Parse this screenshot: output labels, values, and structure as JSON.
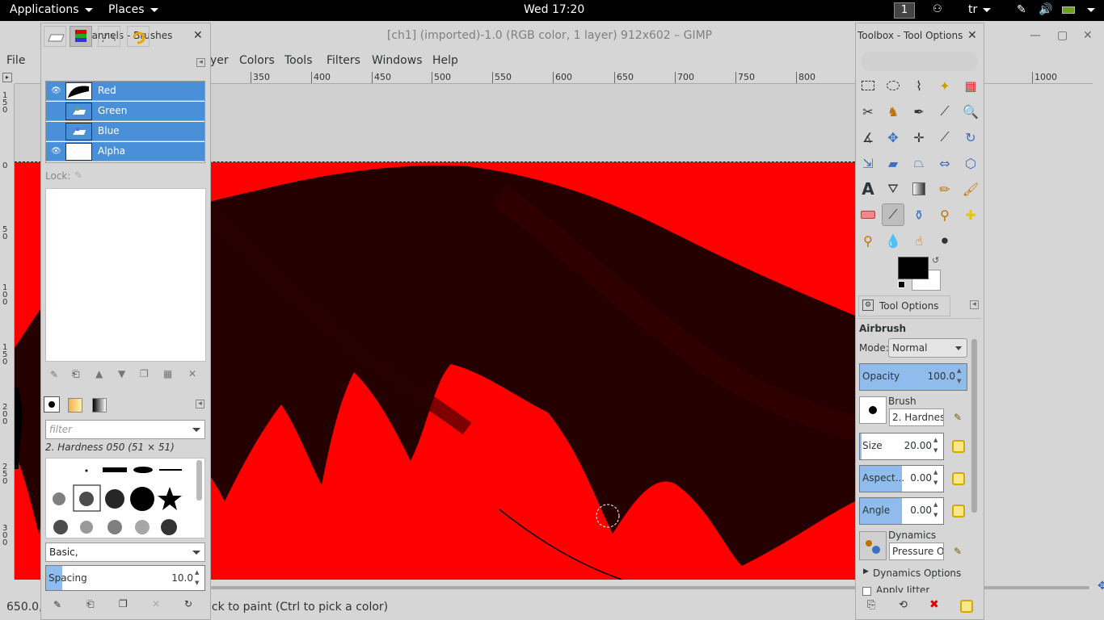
{
  "topbar": {
    "applications": "Applications",
    "places": "Places",
    "clock": "Wed 17:20",
    "workspace": "1",
    "lang": "tr"
  },
  "window": {
    "title": "[ch1] (imported)-1.0 (RGB color, 1 layer) 912x602 – GIMP"
  },
  "menubar": {
    "file": "File",
    "layer_partial": "yer",
    "colors": "Colors",
    "tools": "Tools",
    "filters": "Filters",
    "windows": "Windows",
    "help": "Help"
  },
  "ruler": {
    "h_labels": [
      "350",
      "400",
      "450",
      "500",
      "550",
      "600",
      "650",
      "700",
      "750",
      "800",
      "0",
      "1000"
    ]
  },
  "status": {
    "coords": "650.0,",
    "hint": "ick to paint (Ctrl to pick a color)"
  },
  "channels_dock": {
    "title": "Channels - Brushes",
    "channels": [
      {
        "name": "Red",
        "visible": true
      },
      {
        "name": "Green",
        "visible": false
      },
      {
        "name": "Blue",
        "visible": false
      },
      {
        "name": "Alpha",
        "visible": true
      }
    ],
    "lock_label": "Lock:",
    "filter_placeholder": "filter",
    "brush_name": "2. Hardness 050 (51 × 51)",
    "brush_set": "Basic,",
    "spacing_label": "Spacing",
    "spacing_value": "10.0",
    "spacing_fraction": 0.1
  },
  "toolbox": {
    "title": "Toolbox - Tool Options",
    "tool_options_tab": "Tool Options",
    "tool_name": "Airbrush",
    "mode_label": "Mode:",
    "mode_value": "Normal",
    "opacity_label": "Opacity",
    "opacity_value": "100.0",
    "opacity_fraction": 1.0,
    "brush_label": "Brush",
    "brush_value": "2. Hardness",
    "size_label": "Size",
    "size_value": "20.00",
    "aspect_label": "Aspect...",
    "aspect_value": "0.00",
    "angle_label": "Angle",
    "angle_value": "0.00",
    "dynamics_label": "Dynamics",
    "dynamics_value": "Pressure Op",
    "dynamics_options": "Dynamics Options",
    "apply_jitter": "Apply Jitter",
    "fg_color": "#000000",
    "bg_color": "#ffffff"
  },
  "colors": {
    "accent": "#4a90d9",
    "canvas_red": "#ff0000"
  }
}
